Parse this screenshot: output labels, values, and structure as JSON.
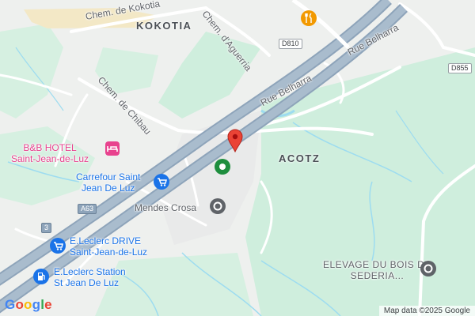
{
  "map": {
    "area_labels": [
      {
        "id": "kokotia",
        "text": "KOKOTIA"
      },
      {
        "id": "acotz",
        "text": "ACOTZ"
      }
    ],
    "street_labels": [
      {
        "id": "chem-kokotia",
        "text": "Chem. de Kokotia"
      },
      {
        "id": "chem-aguerria",
        "text": "Chem. d'Aguerria"
      },
      {
        "id": "rue-belharra-1",
        "text": "Rue Belharra"
      },
      {
        "id": "rue-belharra-2",
        "text": "Rue Belharra"
      },
      {
        "id": "chem-chibau",
        "text": "Chem. de Chibau"
      }
    ],
    "road_shields": [
      {
        "id": "d810",
        "text": "D810"
      },
      {
        "id": "d855",
        "text": "D855"
      },
      {
        "id": "a63",
        "text": "A63"
      },
      {
        "id": "exit3",
        "text": "3"
      }
    ],
    "pois": [
      {
        "id": "bb-hotel",
        "line1": "B&B HOTEL",
        "line2": "Saint-Jean-de-Luz",
        "icon": "hotel-icon",
        "color": "#e8428e"
      },
      {
        "id": "carrefour",
        "line1": "Carrefour Saint",
        "line2": "Jean De Luz",
        "icon": "shopping-cart-icon",
        "color": "#1a73e8"
      },
      {
        "id": "mendes-crosa",
        "line1": "Mendes Crosa",
        "line2": "",
        "icon": "place-icon",
        "color": "#5f6368"
      },
      {
        "id": "leclerc-drive",
        "line1": "E.Leclerc DRIVE",
        "line2": "Saint-Jean-de-Luz",
        "icon": "shopping-cart-icon",
        "color": "#1a73e8"
      },
      {
        "id": "leclerc-station",
        "line1": "E.Leclerc Station",
        "line2": "St Jean De Luz",
        "icon": "gas-station-icon",
        "color": "#1a73e8"
      },
      {
        "id": "elevage",
        "line1": "ELEVAGE DU BOIS DE",
        "line2": "SEDERIA...",
        "icon": "place-icon",
        "color": "#5f6368"
      }
    ],
    "attribution": "Map data ©2025 Google",
    "logo": "Google",
    "colors": {
      "background": "#eef0ee",
      "green": "#cfeedd",
      "water": "#9ddcf0",
      "road": "#ffffff",
      "highway": "#8ea4ba",
      "sand": "#f3e8c6",
      "pin": "#ea4335",
      "hotel": "#e8428e",
      "shop": "#1a73e8",
      "restaurant": "#f29900",
      "park": "#1e8e3e"
    }
  }
}
